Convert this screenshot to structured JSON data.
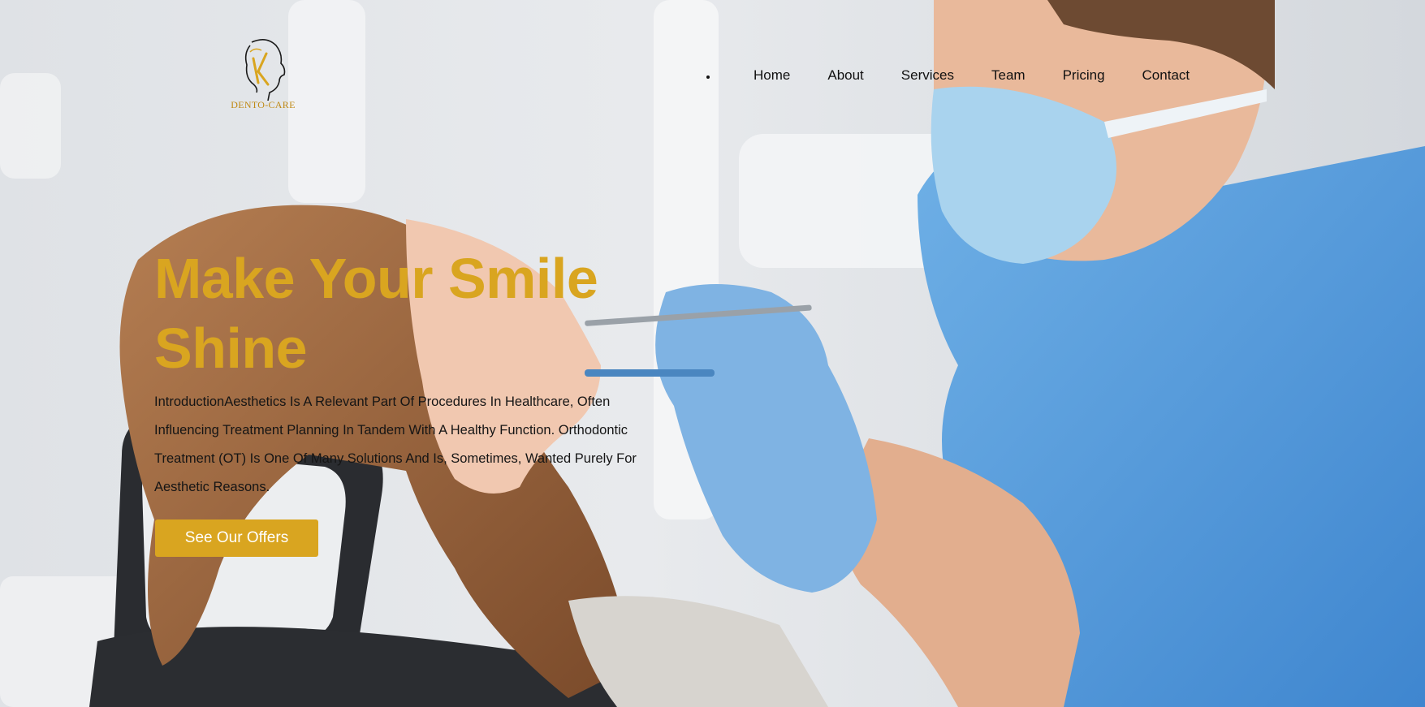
{
  "brand": {
    "name": "DENTO-CARE",
    "accent_color": "#d9a520"
  },
  "nav": {
    "items": [
      {
        "label": "Home"
      },
      {
        "label": "About"
      },
      {
        "label": "Services"
      },
      {
        "label": "Team"
      },
      {
        "label": "Pricing"
      },
      {
        "label": "Contact"
      }
    ]
  },
  "hero": {
    "title": "Make Your Smile Shine",
    "description": "IntroductionAesthetics Is A Relevant Part Of Procedures In Healthcare, Often Influencing Treatment Planning In Tandem With A Healthy Function. Orthodontic Treatment (OT) Is One Of Many Solutions And Is, Sometimes, Wanted Purely For Aesthetic Reasons.",
    "cta_label": "See Our Offers",
    "background_image": "dentist-treating-patient-photo"
  }
}
